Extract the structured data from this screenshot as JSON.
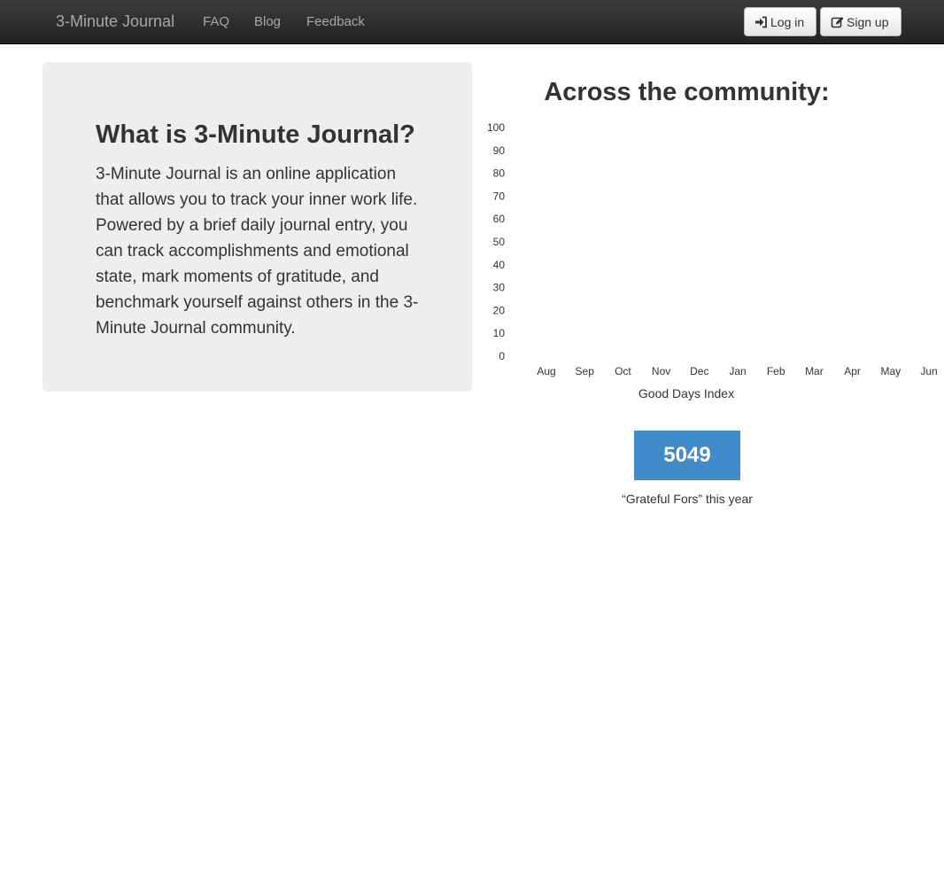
{
  "navbar": {
    "brand": "3-Minute Journal",
    "links": [
      "FAQ",
      "Blog",
      "Feedback"
    ],
    "login_label": "Log in",
    "signup_label": "Sign up"
  },
  "hero": {
    "title": "What is 3-Minute Journal?",
    "text": "3-Minute Journal is an online application that allows you to track your inner work life. Powered by a brief daily journal entry, you can track accomplishments and emotional state, mark moments of gratitude, and benchmark yourself against others in the 3-Minute Journal community."
  },
  "community": {
    "title": "Across the community:",
    "stat_value": "5049",
    "stat_caption": "“Grateful Fors” this year"
  },
  "chart_data": {
    "type": "bar",
    "categories": [
      "Aug",
      "Sep",
      "Oct",
      "Nov",
      "Dec",
      "Jan",
      "Feb",
      "Mar",
      "Apr",
      "May",
      "Jun"
    ],
    "values": [
      null,
      null,
      null,
      null,
      null,
      null,
      null,
      null,
      null,
      null,
      null
    ],
    "title": "",
    "xlabel": "Good Days Index",
    "ylabel": "",
    "ylim": [
      0,
      100
    ],
    "yticks": [
      0,
      10,
      20,
      30,
      40,
      50,
      60,
      70,
      80,
      90,
      100
    ],
    "grid": false
  },
  "icons": {
    "login": "sign-in-icon",
    "signup": "edit-icon"
  }
}
